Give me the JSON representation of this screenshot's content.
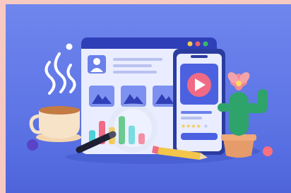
{
  "scene": {
    "description_label": "",
    "colors": {
      "frame_border": "#f6c9c2",
      "background": "#6a80ea",
      "window_header": "#2f3fb8",
      "window_body": "#eef1ff",
      "phone_body": "#2b3c9f",
      "phone_screen": "#4c61e0",
      "play_button": "#f06a86",
      "cactus": "#2ea36a",
      "flower": "#f08a94",
      "pot": "#e59b6a",
      "mug": "#f6e3c8",
      "coffee": "#c47a43",
      "pencil": "#f3c64b",
      "ball_left": "#5a43c8",
      "ball_right": "#ff6f7e"
    },
    "window_dots": [
      "#f7c948",
      "#f0606b",
      "#39b86b"
    ],
    "bars": [
      {
        "color": "#4ed0d6",
        "level": 0.45
      },
      {
        "color": "#f06a86",
        "level": 0.75
      },
      {
        "color": "#f7c948",
        "level": 0.55
      },
      {
        "color": "#39b86b",
        "level": 0.9
      },
      {
        "color": "#4ed0d6",
        "level": 0.6
      },
      {
        "color": "#f06a86",
        "level": 0.35
      }
    ],
    "icons": [
      "image-icon",
      "image-icon",
      "image-icon",
      "user-icon",
      "play-icon",
      "star-icon",
      "magnifier-icon"
    ]
  }
}
